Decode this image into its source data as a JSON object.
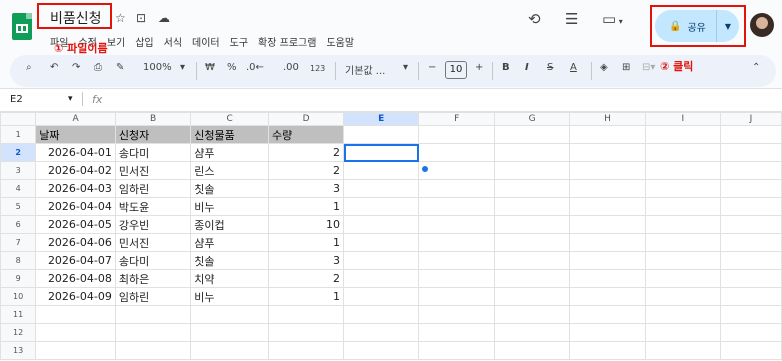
{
  "doc": {
    "title": "비품신청",
    "menu": [
      "파일",
      "수정",
      "보기",
      "삽입",
      "서식",
      "데이터",
      "도구",
      "확장 프로그램",
      "도움말"
    ]
  },
  "annotations": {
    "one": "① 파일이름",
    "two": "② 클릭"
  },
  "share": {
    "label": "공유"
  },
  "toolbar": {
    "zoom": "100%",
    "currency": "₩",
    "percent": "%",
    "dec_less": ".0←",
    "dec_more": ".00",
    "num_fmt": "123",
    "font": "기본값 ...",
    "font_size": "10",
    "bold": "B",
    "italic": "I",
    "strike": "S",
    "underline": "A"
  },
  "formula": {
    "cell_ref": "E2",
    "fx": "fx"
  },
  "sheet": {
    "columns": [
      "A",
      "B",
      "C",
      "D",
      "E",
      "F",
      "G",
      "H",
      "I",
      "J"
    ],
    "header": [
      "날짜",
      "신청자",
      "신청물품",
      "수량"
    ],
    "rows": [
      [
        "2026-04-01",
        "송다미",
        "샴푸",
        "2"
      ],
      [
        "2026-04-02",
        "민서진",
        "린스",
        "2"
      ],
      [
        "2026-04-03",
        "임하린",
        "칫솔",
        "3"
      ],
      [
        "2026-04-04",
        "박도윤",
        "비누",
        "1"
      ],
      [
        "2026-04-05",
        "강우빈",
        "종이컵",
        "10"
      ],
      [
        "2026-04-06",
        "민서진",
        "샴푸",
        "1"
      ],
      [
        "2026-04-07",
        "송다미",
        "칫솔",
        "3"
      ],
      [
        "2026-04-08",
        "최하은",
        "치약",
        "2"
      ],
      [
        "2026-04-09",
        "임하린",
        "비누",
        "1"
      ]
    ],
    "row_numbers": [
      "1",
      "2",
      "3",
      "4",
      "5",
      "6",
      "7",
      "8",
      "9",
      "10",
      "11",
      "12",
      "13"
    ]
  }
}
